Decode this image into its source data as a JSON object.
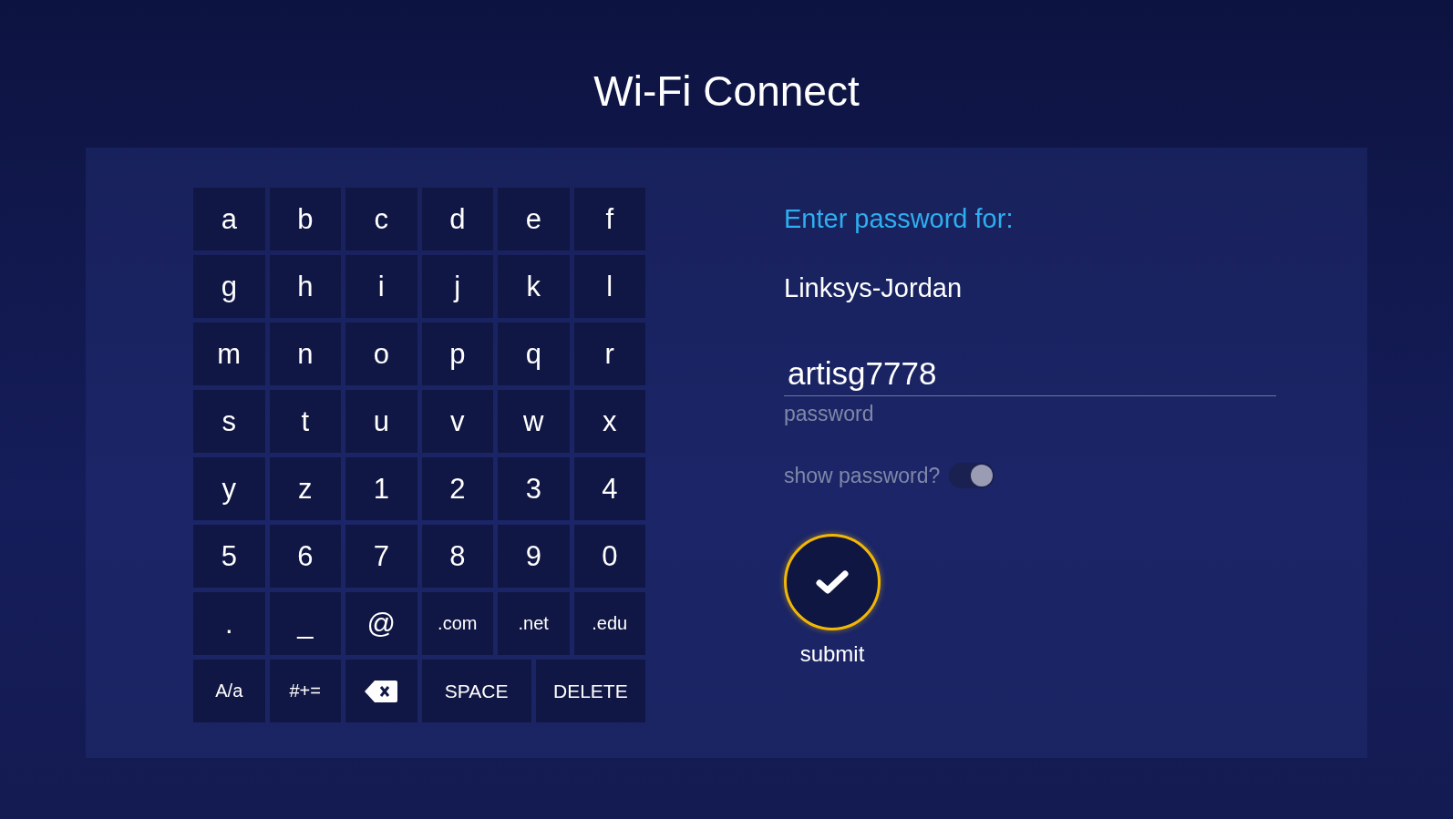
{
  "title": "Wi-Fi Connect",
  "keyboard": {
    "rows": [
      [
        {
          "kind": "char",
          "label": "a"
        },
        {
          "kind": "char",
          "label": "b"
        },
        {
          "kind": "char",
          "label": "c"
        },
        {
          "kind": "char",
          "label": "d"
        },
        {
          "kind": "char",
          "label": "e"
        },
        {
          "kind": "char",
          "label": "f"
        }
      ],
      [
        {
          "kind": "char",
          "label": "g"
        },
        {
          "kind": "char",
          "label": "h"
        },
        {
          "kind": "char",
          "label": "i"
        },
        {
          "kind": "char",
          "label": "j"
        },
        {
          "kind": "char",
          "label": "k"
        },
        {
          "kind": "char",
          "label": "l"
        }
      ],
      [
        {
          "kind": "char",
          "label": "m"
        },
        {
          "kind": "char",
          "label": "n"
        },
        {
          "kind": "char",
          "label": "o"
        },
        {
          "kind": "char",
          "label": "p"
        },
        {
          "kind": "char",
          "label": "q"
        },
        {
          "kind": "char",
          "label": "r"
        }
      ],
      [
        {
          "kind": "char",
          "label": "s"
        },
        {
          "kind": "char",
          "label": "t"
        },
        {
          "kind": "char",
          "label": "u"
        },
        {
          "kind": "char",
          "label": "v"
        },
        {
          "kind": "char",
          "label": "w"
        },
        {
          "kind": "char",
          "label": "x"
        }
      ],
      [
        {
          "kind": "char",
          "label": "y"
        },
        {
          "kind": "char",
          "label": "z"
        },
        {
          "kind": "char",
          "label": "1"
        },
        {
          "kind": "char",
          "label": "2"
        },
        {
          "kind": "char",
          "label": "3"
        },
        {
          "kind": "char",
          "label": "4"
        }
      ],
      [
        {
          "kind": "char",
          "label": "5"
        },
        {
          "kind": "char",
          "label": "6"
        },
        {
          "kind": "char",
          "label": "7"
        },
        {
          "kind": "char",
          "label": "8"
        },
        {
          "kind": "char",
          "label": "9"
        },
        {
          "kind": "char",
          "label": "0"
        }
      ],
      [
        {
          "kind": "char",
          "label": "."
        },
        {
          "kind": "char",
          "label": "_"
        },
        {
          "kind": "char",
          "label": "@"
        },
        {
          "kind": "small",
          "label": ".com"
        },
        {
          "kind": "small",
          "label": ".net"
        },
        {
          "kind": "small",
          "label": ".edu"
        }
      ]
    ],
    "bottom_row": [
      {
        "kind": "small",
        "label": "A/a"
      },
      {
        "kind": "small",
        "label": "#+="
      },
      {
        "kind": "backspace"
      },
      {
        "kind": "wide",
        "label": "SPACE"
      },
      {
        "kind": "wide",
        "label": "DELETE"
      }
    ]
  },
  "form": {
    "prompt": "Enter password for:",
    "network": "Linksys-Jordan",
    "password_field": {
      "value": "artisg7778",
      "label": "password"
    },
    "show_password": {
      "label": "show password?",
      "on": true
    },
    "submit": {
      "label": "submit"
    }
  }
}
